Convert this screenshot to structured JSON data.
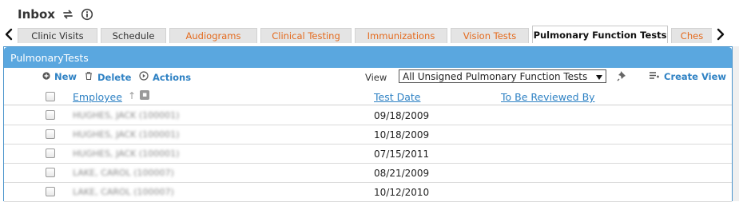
{
  "header": {
    "title": "Inbox",
    "refresh_icon": "refresh-icon",
    "info_icon": "info-icon"
  },
  "tabs": [
    {
      "label": "Clinic Visits",
      "color": "#333333",
      "active": false
    },
    {
      "label": "Schedule",
      "color": "#333333",
      "active": false
    },
    {
      "label": "Audiograms",
      "color": "#e46a1d",
      "active": false
    },
    {
      "label": "Clinical Testing",
      "color": "#e46a1d",
      "active": false
    },
    {
      "label": "Immunizations",
      "color": "#e46a1d",
      "active": false
    },
    {
      "label": "Vision Tests",
      "color": "#e46a1d",
      "active": false
    },
    {
      "label": "Pulmonary Function Tests",
      "color": "#111111",
      "active": true
    },
    {
      "label": "Ches",
      "color": "#e46a1d",
      "active": false
    }
  ],
  "panel": {
    "title": "PulmonaryTests",
    "accent": "#5aa7df"
  },
  "toolbar": {
    "new_label": "New",
    "delete_label": "Delete",
    "actions_label": "Actions",
    "view_label": "View",
    "view_selected": "All Unsigned Pulmonary Function Tests",
    "create_view_label": "Create View"
  },
  "grid": {
    "columns": {
      "employee": "Employee",
      "test_date": "Test Date",
      "to_be_reviewed_by": "To Be Reviewed By"
    },
    "rows": [
      {
        "employee": "HUGHES, JACK (100001)",
        "test_date": "09/18/2009",
        "reviewer": ""
      },
      {
        "employee": "HUGHES, JACK (100001)",
        "test_date": "10/18/2009",
        "reviewer": ""
      },
      {
        "employee": "HUGHES, JACK (100001)",
        "test_date": "07/15/2011",
        "reviewer": ""
      },
      {
        "employee": "LAKE, CAROL (100007)",
        "test_date": "08/21/2009",
        "reviewer": ""
      },
      {
        "employee": "LAKE, CAROL (100007)",
        "test_date": "10/12/2010",
        "reviewer": ""
      }
    ]
  }
}
